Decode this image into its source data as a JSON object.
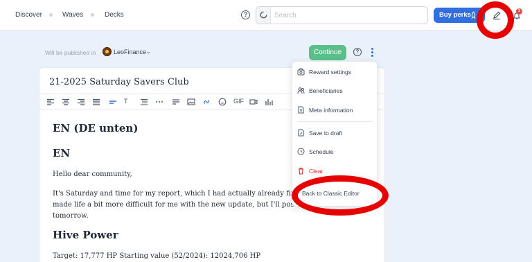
{
  "nav": {
    "items": [
      {
        "label": "Discover"
      },
      {
        "label": "Waves"
      },
      {
        "label": "Decks"
      }
    ]
  },
  "header": {
    "search_placeholder": "Search",
    "buy_perks_label": "Buy perks",
    "notification_count": "3",
    "icons": [
      "help-icon",
      "search-icon",
      "rocket-icon",
      "pen-icon",
      "bell-icon"
    ]
  },
  "publish": {
    "label": "Will be published in",
    "community": "LeoFinance",
    "continue_label": "Continue"
  },
  "editor": {
    "title": "21-2025 Saturday Savers Club",
    "toolbar_text": {
      "size": "T",
      "gif": "GIF"
    },
    "content": {
      "heading1": "EN (DE unten)",
      "heading2": "EN",
      "para1": "Hello dear community,",
      "para2_line1": "It's Saturday and time for my report, which I had actually already finis",
      "para2_line2": "made life a bit more difficult for me with the new update, but I'll post so",
      "para2_line3": "tomorrow.",
      "heading3": "Hive Power",
      "para3": "Target: 17,777 HP Starting value (52/2024): 12024,706 HP"
    }
  },
  "menu": {
    "items": [
      {
        "label": "Reward settings",
        "icon": "reward-icon"
      },
      {
        "label": "Beneficiaries",
        "icon": "users-icon"
      },
      {
        "label": "Meta information",
        "icon": "document-icon"
      },
      {
        "label": "Save to draft",
        "icon": "draft-icon"
      },
      {
        "label": "Schedule",
        "icon": "clock-icon"
      },
      {
        "label": "Clear",
        "icon": "trash-icon"
      },
      {
        "label": "Back to Classic Editor",
        "icon": ""
      }
    ]
  },
  "colors": {
    "primary": "#2f6fe0",
    "success": "#5ac08a",
    "danger": "#dc2626",
    "annotation": "#e60000",
    "page_bg": "#eaf1fb"
  }
}
